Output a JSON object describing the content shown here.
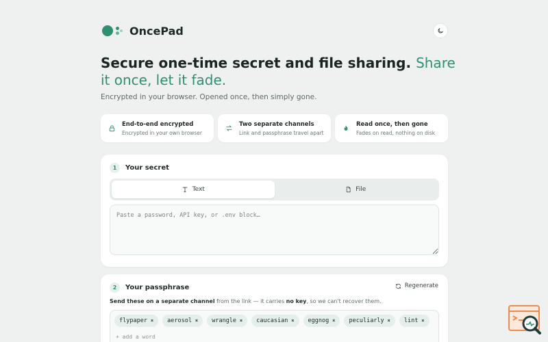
{
  "header": {
    "brand": "OncePad",
    "theme_toggle": "moon-icon"
  },
  "hero": {
    "title_main": "Secure one-time secret and file sharing.",
    "title_accent": "Share it once, let it fade.",
    "subtitle": "Encrypted in your browser. Opened once, then simply gone."
  },
  "features": [
    {
      "icon": "lock-icon",
      "title": "End-to-end encrypted",
      "desc": "Encrypted in your own browser"
    },
    {
      "icon": "swap-arrows-icon",
      "title": "Two separate channels",
      "desc": "Link and passphrase travel apart"
    },
    {
      "icon": "flame-icon",
      "title": "Read once, then gone",
      "desc": "Fades on read, nothing on disk"
    }
  ],
  "secret": {
    "step": "1",
    "title": "Your secret",
    "tabs": [
      {
        "label": "Text",
        "icon": "text-icon",
        "active": true
      },
      {
        "label": "File",
        "icon": "file-icon",
        "active": false
      }
    ],
    "placeholder": "Paste a password, API key, or .env block…"
  },
  "passphrase": {
    "step": "2",
    "title": "Your passphrase",
    "regenerate": "Regenerate",
    "note_a": "Send these on a separate channel",
    "note_b": " from the link — it carries ",
    "note_c": "no key",
    "note_d": ", so we can't recover them.",
    "words": [
      "flypaper",
      "aerosol",
      "wrangle",
      "caucasian",
      "eggnog",
      "peculiarly",
      "lint"
    ],
    "remove_symbol": "✖",
    "add_placeholder": "+ add a word"
  },
  "colors": {
    "accent": "#2e8f73",
    "background": "#eef1f0",
    "chip": "#e4efeb"
  }
}
